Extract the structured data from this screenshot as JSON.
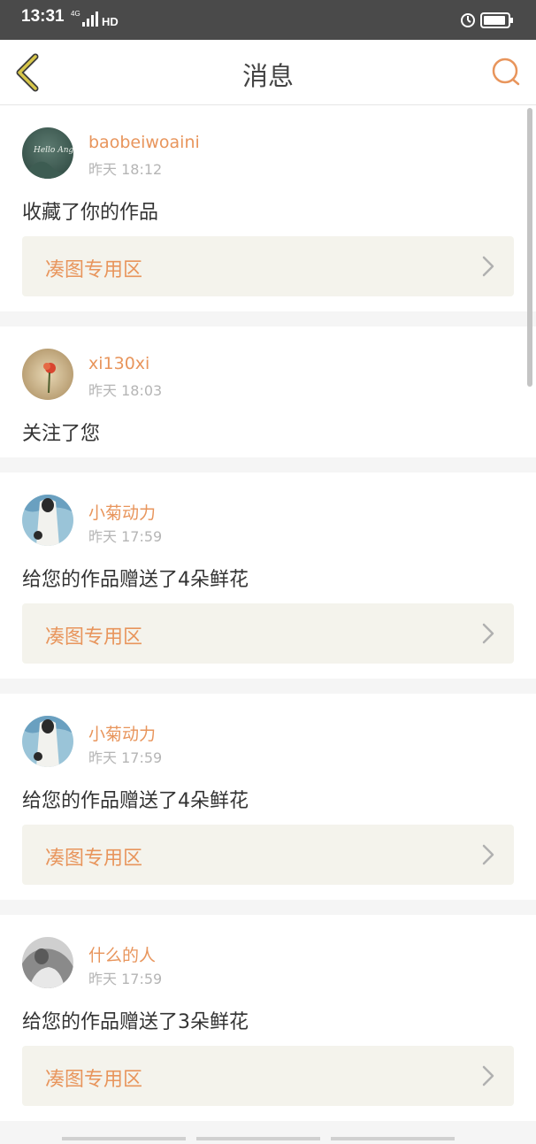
{
  "status_bar": {
    "time": "13:31",
    "network": "4G",
    "hd": "HD"
  },
  "nav": {
    "title": "消息",
    "back_icon": "chevron-left-icon",
    "search_icon": "search-icon"
  },
  "colors": {
    "accent": "#e8955c",
    "back_icon": "#d7c64a",
    "ref_bg": "#f4f3ec"
  },
  "messages": [
    {
      "username": "baobeiwoaini",
      "time": "昨天 18:12",
      "action": "收藏了你的作品",
      "ref_label": "凑图专用区",
      "avatar_text": "Hello Angel"
    },
    {
      "username": "xi130xi",
      "time": "昨天 18:03",
      "action": "关注了您"
    },
    {
      "username": "小菊动力",
      "time": "昨天 17:59",
      "action": "给您的作品赠送了4朵鲜花",
      "ref_label": "凑图专用区"
    },
    {
      "username": "小菊动力",
      "time": "昨天 17:59",
      "action": "给您的作品赠送了4朵鲜花",
      "ref_label": "凑图专用区"
    },
    {
      "username": "什么的人",
      "time": "昨天 17:59",
      "action": "给您的作品赠送了3朵鲜花",
      "ref_label": "凑图专用区"
    }
  ]
}
